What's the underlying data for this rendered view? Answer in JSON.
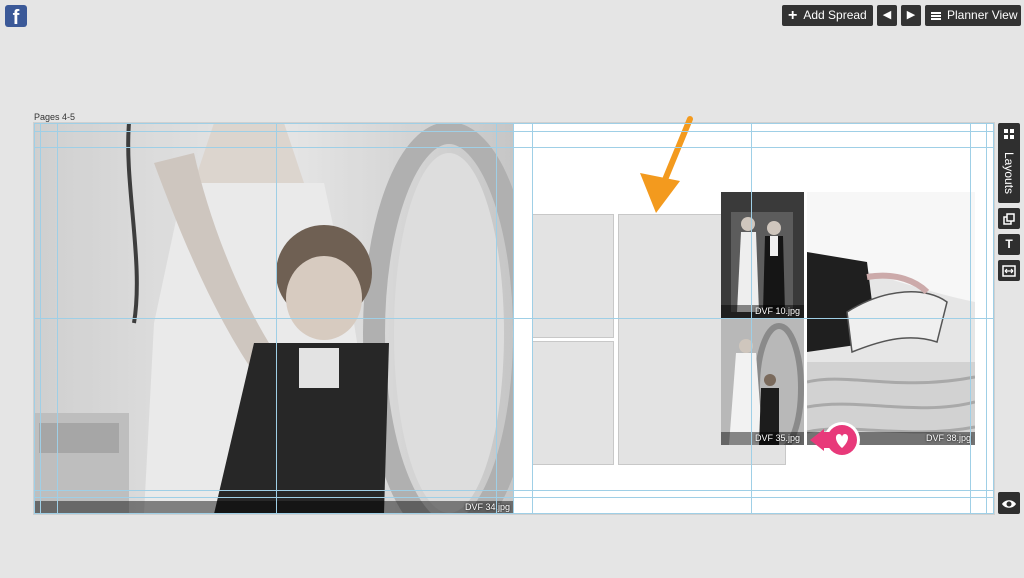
{
  "topbar": {
    "facebook_glyph": "f",
    "add_spread_label": "Add Spread",
    "prev_label": "◀",
    "next_label": "▶",
    "planner_label": "Planner View"
  },
  "spread": {
    "pages_label": "Pages 4-5",
    "left_photo": {
      "filename": "DVF 34.jpg"
    },
    "right_photos": [
      {
        "filename": "DVF 10.jpg"
      },
      {
        "filename": "DVF 35.jpg"
      },
      {
        "filename": "DVF 38.jpg"
      }
    ]
  },
  "sidebar": {
    "layouts_label": "Layouts",
    "text_tool_glyph": "T"
  },
  "colors": {
    "accent_orange": "#f39a1e",
    "favorite_pink": "#e8397a",
    "guide_blue": "#9fcfe6",
    "toolbar_dark": "#333333"
  }
}
